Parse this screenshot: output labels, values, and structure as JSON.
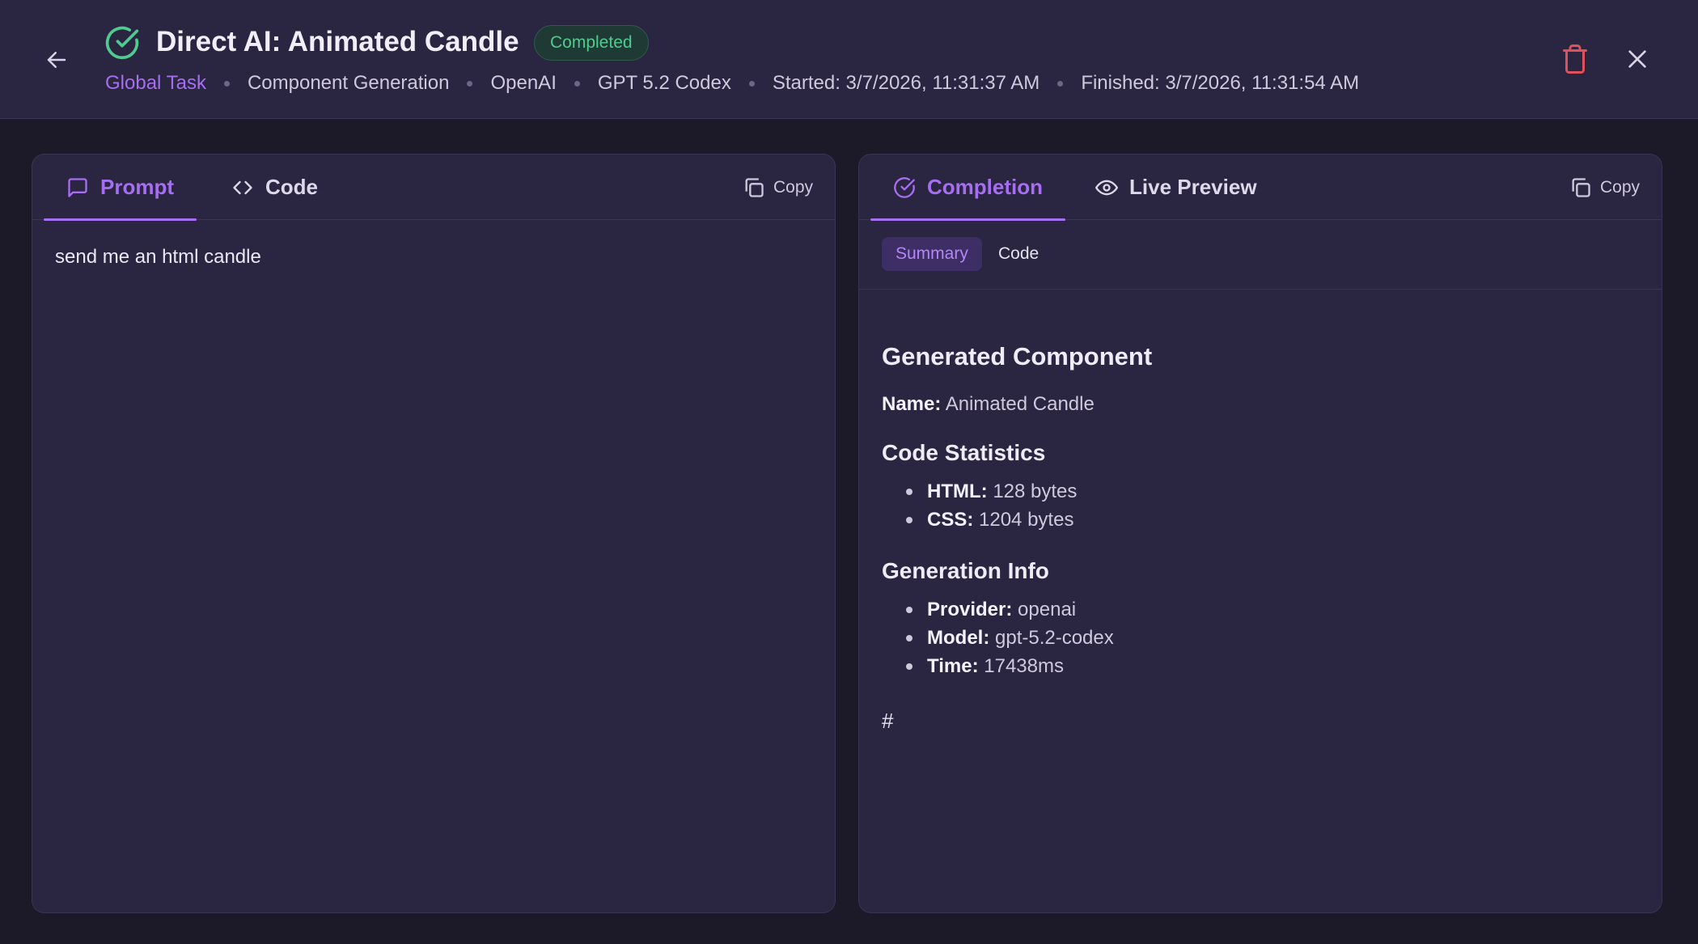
{
  "header": {
    "title": "Direct AI: Animated Candle",
    "status": "Completed",
    "meta": {
      "scope": "Global Task",
      "type": "Component Generation",
      "provider": "OpenAI",
      "model": "GPT 5.2 Codex",
      "started": "Started: 3/7/2026, 11:31:37 AM",
      "finished": "Finished: 3/7/2026, 11:31:54 AM"
    },
    "icons": {
      "back": "arrow-left-icon",
      "status": "check-circle-icon",
      "delete": "trash-icon",
      "close": "close-icon"
    },
    "colors": {
      "accent": "#a66ef0",
      "success": "#4ecb8f",
      "danger": "#e0525b"
    }
  },
  "left_panel": {
    "tabs": [
      {
        "label": "Prompt",
        "icon": "message-square-icon",
        "active": true
      },
      {
        "label": "Code",
        "icon": "code-icon",
        "active": false
      }
    ],
    "copy_label": "Copy",
    "prompt_text": "send me an html candle"
  },
  "right_panel": {
    "tabs": [
      {
        "label": "Completion",
        "icon": "check-circle-icon",
        "active": true
      },
      {
        "label": "Live Preview",
        "icon": "eye-icon",
        "active": false
      }
    ],
    "copy_label": "Copy",
    "subtabs": [
      {
        "label": "Summary",
        "active": true
      },
      {
        "label": "Code",
        "active": false
      }
    ],
    "summary": {
      "heading": "Generated Component",
      "name_label": "Name:",
      "name_value": "Animated Candle",
      "stats_heading": "Code Statistics",
      "stats": [
        {
          "label": "HTML:",
          "value": "128 bytes"
        },
        {
          "label": "CSS:",
          "value": "1204 bytes"
        }
      ],
      "info_heading": "Generation Info",
      "info": [
        {
          "label": "Provider:",
          "value": "openai"
        },
        {
          "label": "Model:",
          "value": "gpt-5.2-codex"
        },
        {
          "label": "Time:",
          "value": "17438ms"
        }
      ],
      "trailing": "#"
    }
  }
}
